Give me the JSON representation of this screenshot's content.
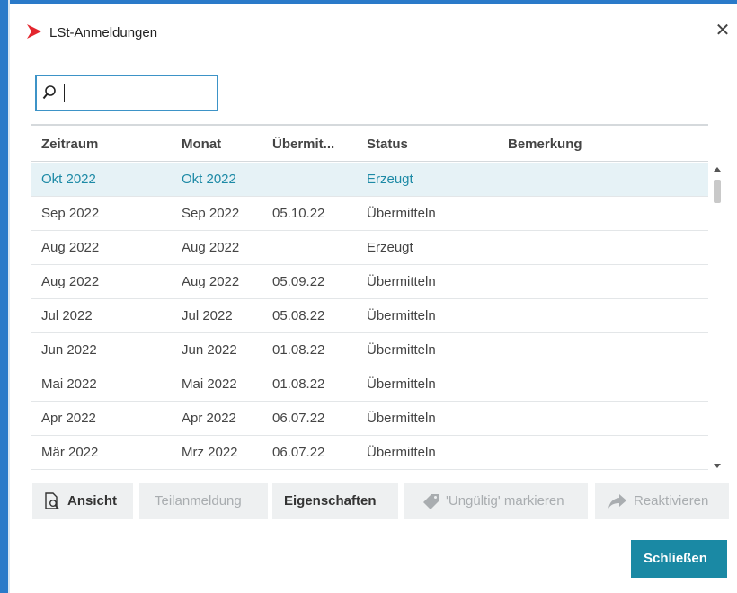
{
  "window": {
    "title": "LSt-Anmeldungen",
    "close_glyph": "✕",
    "accent_color": "#1a89a4",
    "logo_color": "#e3262e"
  },
  "search": {
    "value": "",
    "placeholder": ""
  },
  "table": {
    "columns": [
      "Zeitraum",
      "Monat",
      "Übermit...",
      "Status",
      "Bemerkung"
    ],
    "rows": [
      {
        "zeitraum": "Okt 2022",
        "monat": "Okt 2022",
        "uebermittelt": "",
        "status": "Erzeugt",
        "bemerkung": "",
        "selected": true
      },
      {
        "zeitraum": "Sep 2022",
        "monat": "Sep 2022",
        "uebermittelt": "05.10.22",
        "status": "Übermitteln",
        "bemerkung": ""
      },
      {
        "zeitraum": "Aug 2022",
        "monat": "Aug 2022",
        "uebermittelt": "",
        "status": "Erzeugt",
        "bemerkung": ""
      },
      {
        "zeitraum": "Aug 2022",
        "monat": "Aug 2022",
        "uebermittelt": "05.09.22",
        "status": "Übermitteln",
        "bemerkung": ""
      },
      {
        "zeitraum": "Jul 2022",
        "monat": "Jul 2022",
        "uebermittelt": "05.08.22",
        "status": "Übermitteln",
        "bemerkung": ""
      },
      {
        "zeitraum": "Jun 2022",
        "monat": "Jun 2022",
        "uebermittelt": "01.08.22",
        "status": "Übermitteln",
        "bemerkung": ""
      },
      {
        "zeitraum": "Mai 2022",
        "monat": "Mai 2022",
        "uebermittelt": "01.08.22",
        "status": "Übermitteln",
        "bemerkung": ""
      },
      {
        "zeitraum": "Apr 2022",
        "monat": "Apr 2022",
        "uebermittelt": "06.07.22",
        "status": "Übermitteln",
        "bemerkung": ""
      },
      {
        "zeitraum": "Mär 2022",
        "monat": "Mrz 2022",
        "uebermittelt": "06.07.22",
        "status": "Übermitteln",
        "bemerkung": ""
      }
    ]
  },
  "actions": {
    "ansicht": {
      "label": "Ansicht",
      "icon": "document-search-icon",
      "enabled": true
    },
    "teilanmeldung": {
      "label": "Teilanmeldung",
      "enabled": false
    },
    "eigenschaften": {
      "label": "Eigenschaften",
      "enabled": true
    },
    "ungueltig": {
      "label": "'Ungültig' markieren",
      "icon": "tag-icon",
      "enabled": false
    },
    "reaktivieren": {
      "label": "Reaktivieren",
      "icon": "arrow-forward-icon",
      "enabled": false
    }
  },
  "footer": {
    "close_label": "Schließen"
  }
}
